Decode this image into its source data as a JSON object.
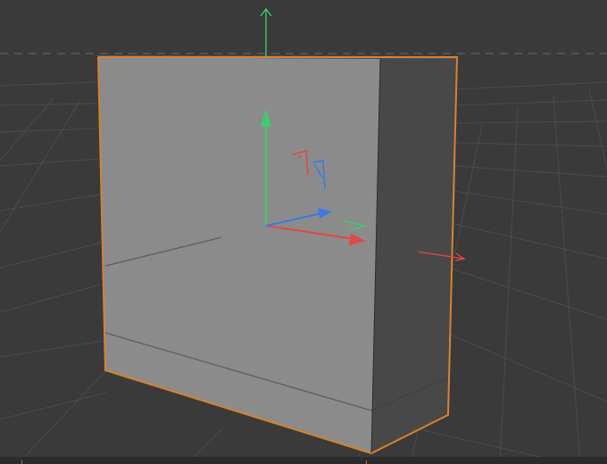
{
  "viewport": {
    "name": "3d-perspective-viewport",
    "background_color": "#3a3a3a",
    "grid_color": "#4a4a4a",
    "horizon_style": "dashed"
  },
  "selected_object": {
    "type": "cube",
    "selected": true,
    "selection_outline_color": "#d9822b",
    "front_face_color": "#8a8a8a",
    "side_face_color": "#4a4a4a"
  },
  "axes": {
    "x_color": "#e04848",
    "y_color": "#3ccf6a",
    "z_color": "#3b7be0"
  },
  "icons": [
    "world-y-axis-arrow-icon",
    "world-x-axis-arrow-icon",
    "move-gizmo-icon",
    "rotate-handle-icon",
    "scale-handle-icon"
  ]
}
